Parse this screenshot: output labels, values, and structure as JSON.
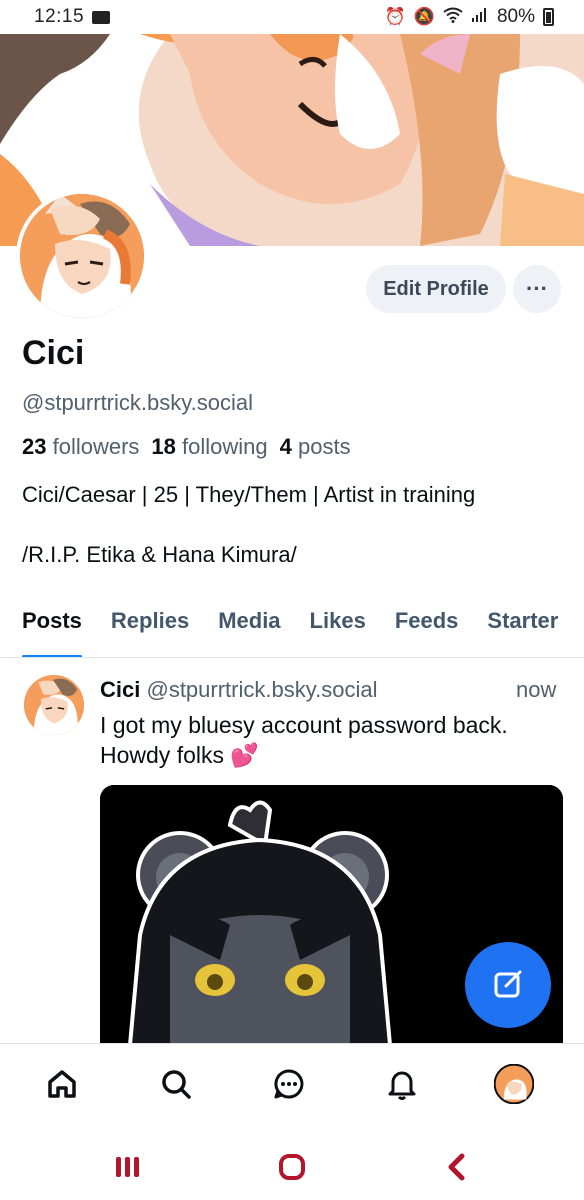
{
  "status_bar": {
    "time": "12:15",
    "battery": "80%"
  },
  "profile": {
    "name": "Cici",
    "handle": "@stpurrtrick.bsky.social",
    "stats": [
      {
        "count": "23",
        "label": "followers"
      },
      {
        "count": "18",
        "label": "following"
      },
      {
        "count": "4",
        "label": "posts"
      }
    ],
    "bio_lines": [
      "Cici/Caesar | 25 | They/Them | Artist in training",
      "/R.I.P. Etika & Hana Kimura/"
    ],
    "edit_label": "Edit Profile",
    "more_label": "···"
  },
  "tabs": [
    "Posts",
    "Replies",
    "Media",
    "Likes",
    "Feeds",
    "Starter"
  ],
  "post": {
    "author": "Cici",
    "handle": "@stpurrtrick.bsky.social",
    "time": "now",
    "text": "I got my bluesy account password back. Howdy folks 💕"
  },
  "bottom_nav": [
    "home-icon",
    "search-icon",
    "chat-icon",
    "bell-icon",
    "profile-avatar"
  ],
  "colors": {
    "accent": "#1083fe",
    "fab": "#1f72f2",
    "muted": "#52606d",
    "tab": "#42576c",
    "system_nav": "#b3162c"
  }
}
